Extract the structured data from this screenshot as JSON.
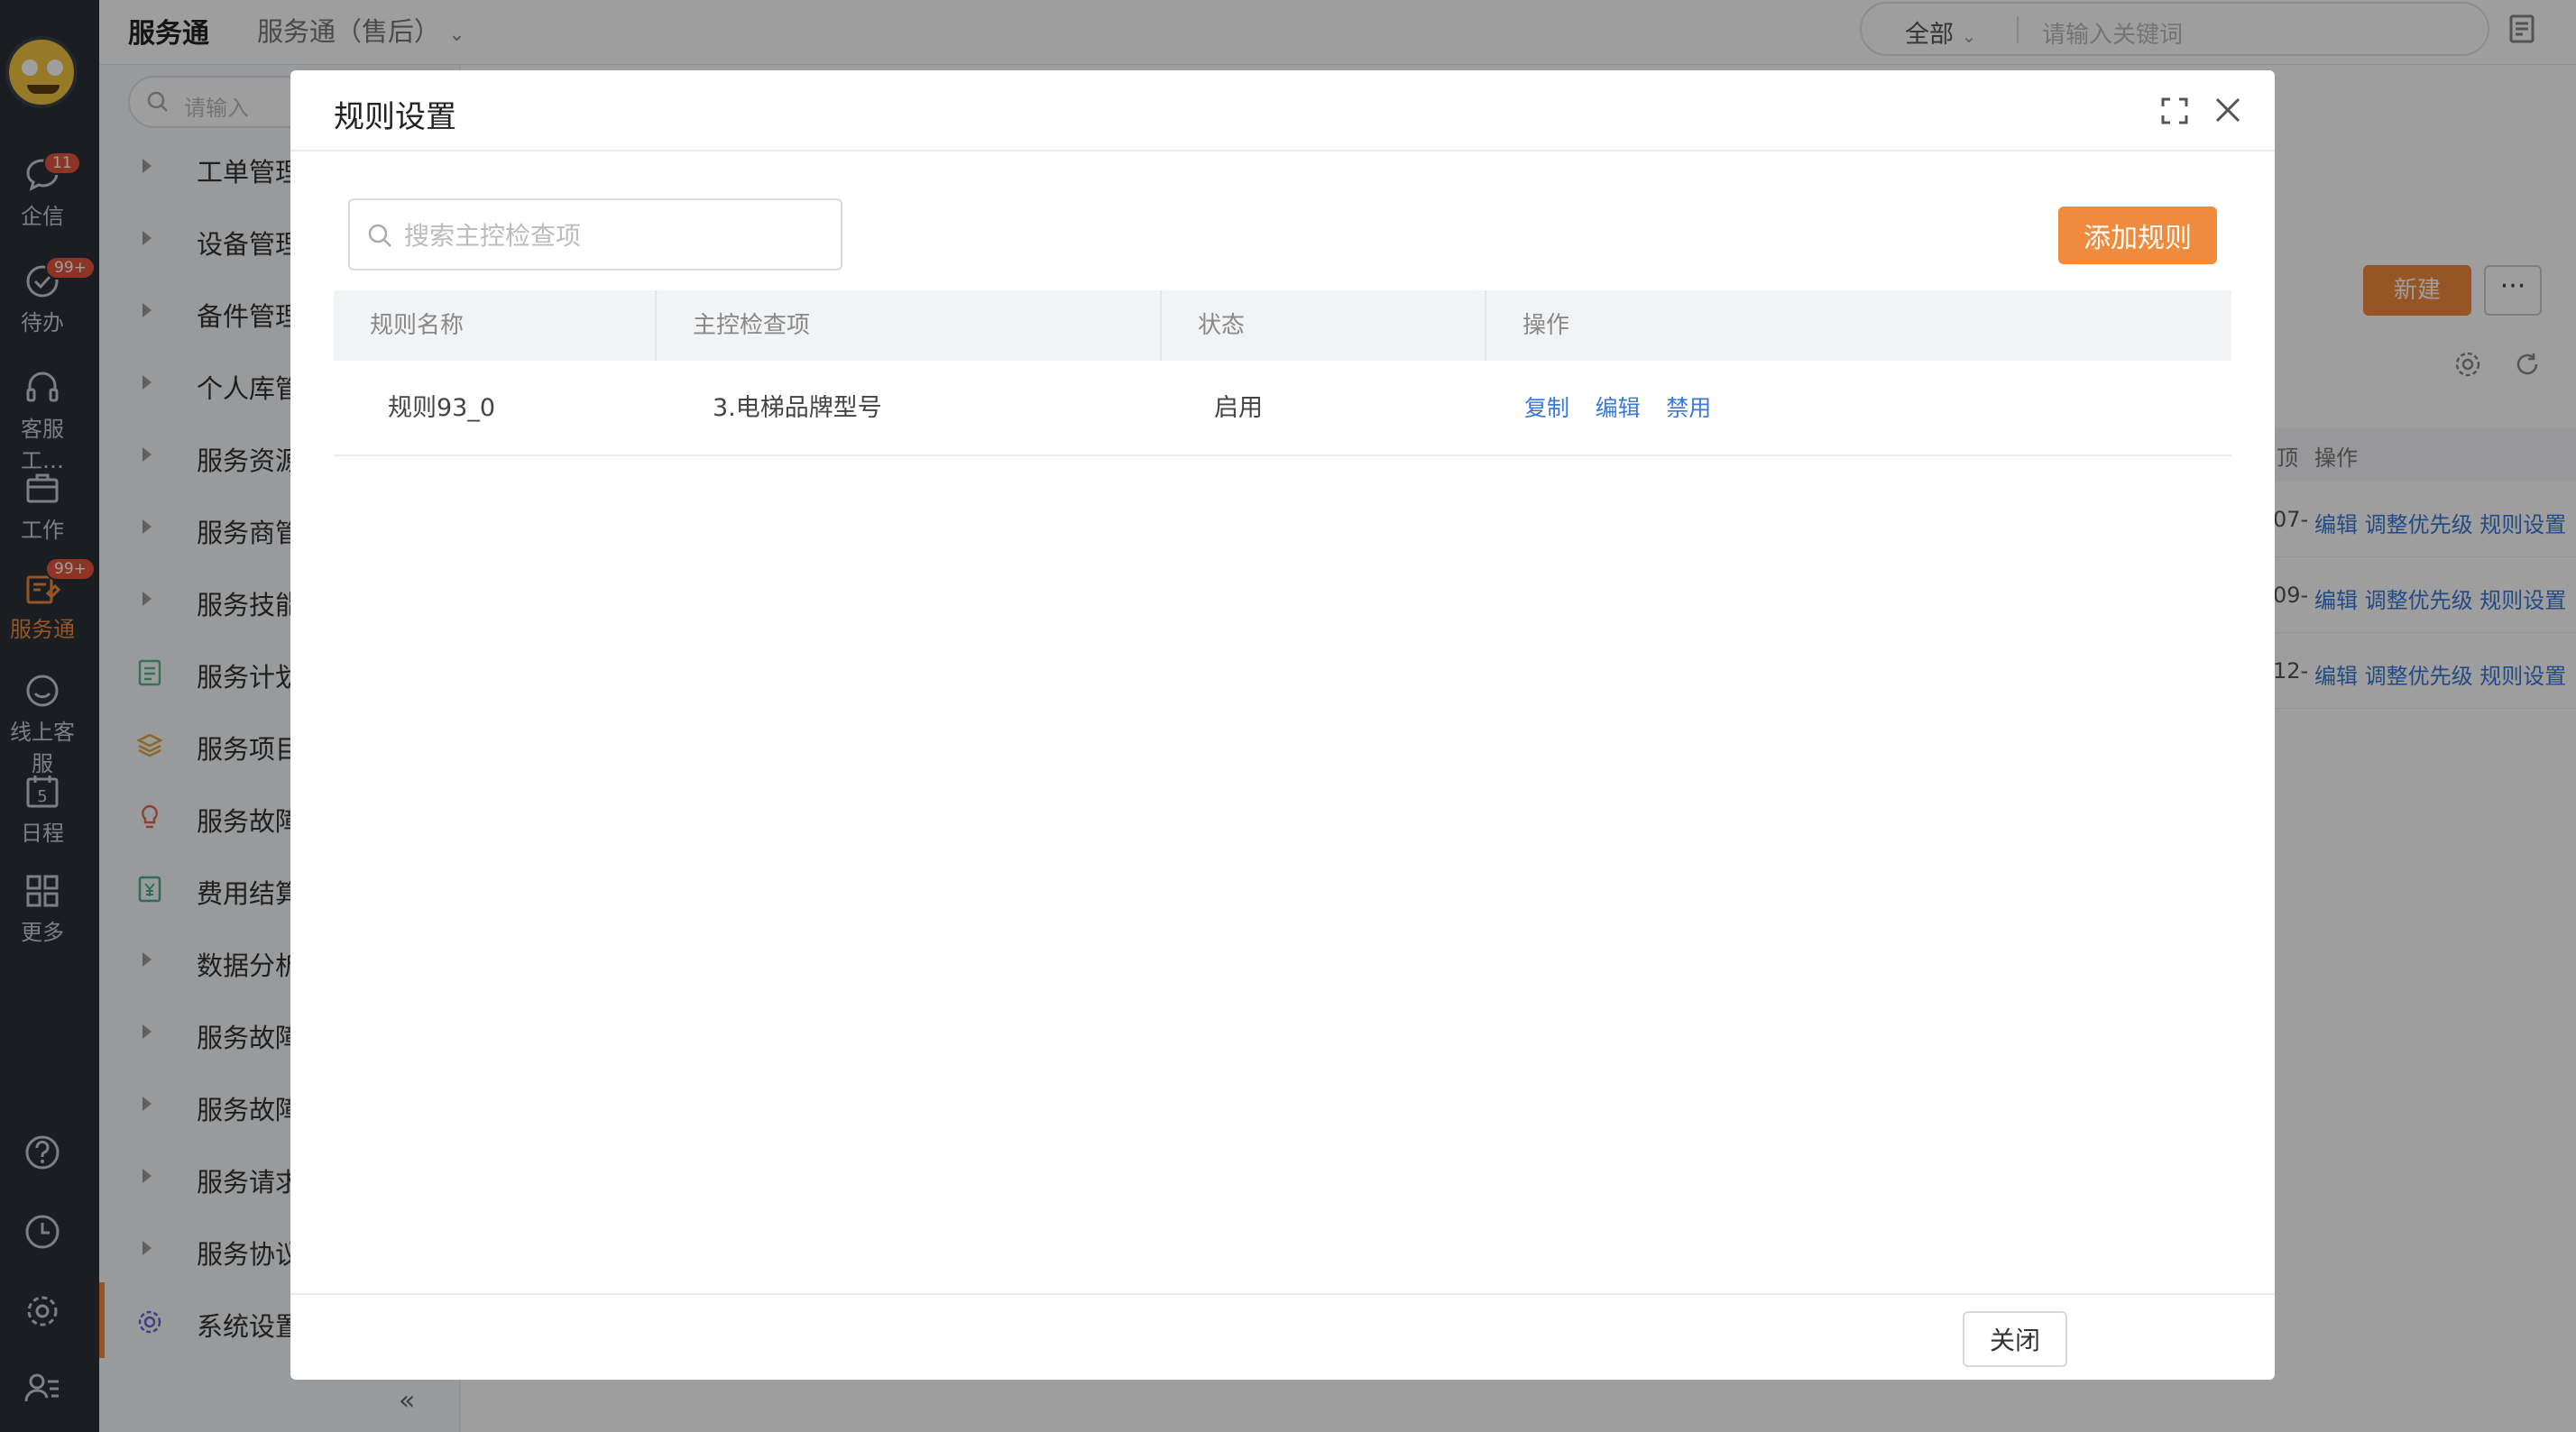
{
  "rail": {
    "items": [
      {
        "label": "企信",
        "badge": "11",
        "icon": "chat-bubble-icon"
      },
      {
        "label": "待办",
        "badge": "99+",
        "icon": "check-circle-icon"
      },
      {
        "label": "客服工…",
        "badge": "",
        "icon": "headset-icon"
      },
      {
        "label": "工作",
        "badge": "",
        "icon": "briefcase-icon"
      },
      {
        "label": "服务通",
        "badge": "99+",
        "icon": "service-icon"
      },
      {
        "label": "线上客服",
        "badge": "",
        "icon": "smile-chat-icon"
      },
      {
        "label": "日程",
        "badge": "",
        "icon": "calendar-icon",
        "glyph": "5"
      },
      {
        "label": "更多",
        "badge": "",
        "icon": "grid-icon"
      }
    ],
    "bottom_icons": [
      "help-icon",
      "clock-icon",
      "gear-icon",
      "user-list-icon"
    ]
  },
  "topbar": {
    "brand": "服务通",
    "subtitle": "服务通（售后）",
    "scope": "全部",
    "search_placeholder": "请输入关键词"
  },
  "sidebar": {
    "search_placeholder": "请输入",
    "items": [
      {
        "label": "工单管理"
      },
      {
        "label": "设备管理"
      },
      {
        "label": "备件管理"
      },
      {
        "label": "个人库管理"
      },
      {
        "label": "服务资源管"
      },
      {
        "label": "服务商管理"
      },
      {
        "label": "服务技能管"
      },
      {
        "label": "服务计划"
      },
      {
        "label": "服务项目"
      },
      {
        "label": "服务故障（"
      },
      {
        "label": "费用结算"
      },
      {
        "label": "数据分析"
      },
      {
        "label": "服务故障查"
      },
      {
        "label": "服务故障管"
      },
      {
        "label": "服务请求管"
      },
      {
        "label": "服务协议管"
      },
      {
        "label": "系统设置"
      }
    ],
    "collapse_glyph": "«"
  },
  "background": {
    "new_button": "新建",
    "more_button": "···",
    "header_stub": "顶",
    "header_ops": "操作",
    "rows": [
      {
        "stub": "07-",
        "edit": "编辑",
        "priority": "调整优先级",
        "rules": "规则设置"
      },
      {
        "stub": "09-",
        "edit": "编辑",
        "priority": "调整优先级",
        "rules": "规则设置"
      },
      {
        "stub": "12-",
        "edit": "编辑",
        "priority": "调整优先级",
        "rules": "规则设置"
      }
    ]
  },
  "modal": {
    "title": "规则设置",
    "search_placeholder": "搜索主控检查项",
    "search_value": "",
    "add_button": "添加规则",
    "columns": [
      "规则名称",
      "主控检查项",
      "状态",
      "操作"
    ],
    "rows": [
      {
        "name": "规则93_0",
        "check_item": "3.电梯品牌型号",
        "status": "启用",
        "actions": [
          "复制",
          "编辑",
          "禁用"
        ]
      }
    ],
    "close_button": "关闭"
  },
  "colors": {
    "accent": "#f08a3c",
    "link": "#3a78d8",
    "rail_bg": "#2b2f36",
    "badge": "#e5553d"
  }
}
